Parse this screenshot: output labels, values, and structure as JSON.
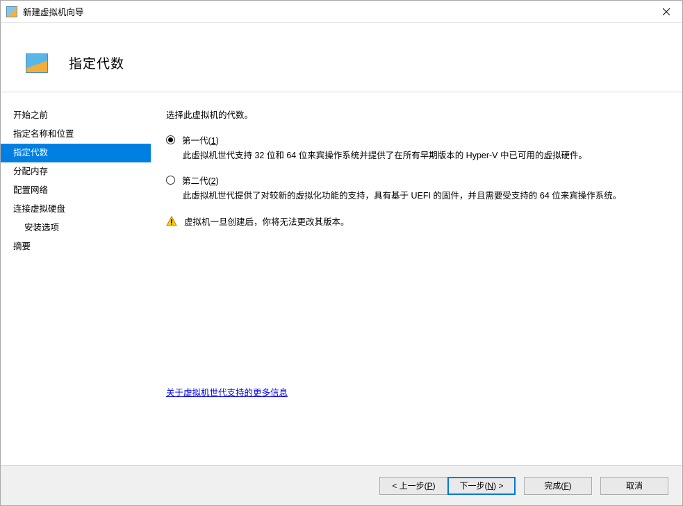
{
  "window": {
    "title": "新建虚拟机向导"
  },
  "header": {
    "page_title": "指定代数"
  },
  "sidebar": {
    "items": [
      {
        "label": "开始之前",
        "active": false,
        "indent": false
      },
      {
        "label": "指定名称和位置",
        "active": false,
        "indent": false
      },
      {
        "label": "指定代数",
        "active": true,
        "indent": false
      },
      {
        "label": "分配内存",
        "active": false,
        "indent": false
      },
      {
        "label": "配置网络",
        "active": false,
        "indent": false
      },
      {
        "label": "连接虚拟硬盘",
        "active": false,
        "indent": false
      },
      {
        "label": "安装选项",
        "active": false,
        "indent": true
      },
      {
        "label": "摘要",
        "active": false,
        "indent": false
      }
    ]
  },
  "content": {
    "intro": "选择此虚拟机的代数。",
    "gen1": {
      "label_pre": "第一代(",
      "label_key": "1",
      "label_post": ")",
      "checked": true,
      "desc": "此虚拟机世代支持 32 位和 64 位来宾操作系统并提供了在所有早期版本的 Hyper-V 中已可用的虚拟硬件。"
    },
    "gen2": {
      "label_pre": "第二代(",
      "label_key": "2",
      "label_post": ")",
      "checked": false,
      "desc": "此虚拟机世代提供了对较新的虚拟化功能的支持，具有基于 UEFI 的固件，并且需要受支持的 64 位来宾操作系统。"
    },
    "warning": "虚拟机一旦创建后，你将无法更改其版本。",
    "more_link": "关于虚拟机世代支持的更多信息"
  },
  "footer": {
    "prev": {
      "pre": "< 上一步(",
      "key": "P",
      "post": ")"
    },
    "next": {
      "pre": "下一步(",
      "key": "N",
      "post": ") >"
    },
    "finish": {
      "pre": "完成(",
      "key": "F",
      "post": ")"
    },
    "cancel": "取消"
  }
}
